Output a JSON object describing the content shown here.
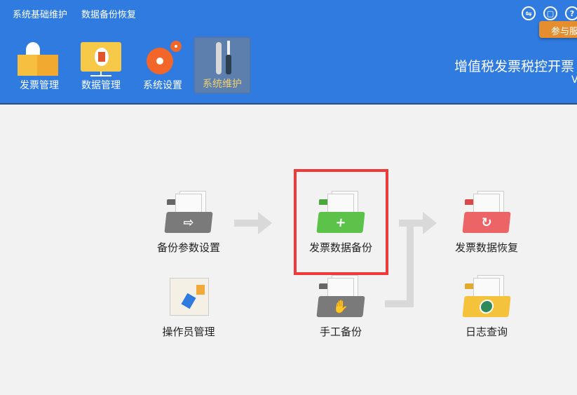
{
  "topmenu": [
    "系统基础维护",
    "数据备份恢复"
  ],
  "nav": [
    {
      "label": "发票管理",
      "icon": "invoice-box-icon"
    },
    {
      "label": "数据管理",
      "icon": "data-folder-icon"
    },
    {
      "label": "系统设置",
      "icon": "gear-icon"
    },
    {
      "label": "系统维护",
      "icon": "tools-icon",
      "active": true
    }
  ],
  "tool_icons": [
    {
      "name": "switch-icon",
      "glyph": "⇋"
    },
    {
      "name": "feedback-icon",
      "glyph": "▢"
    },
    {
      "name": "help-icon",
      "glyph": "?"
    }
  ],
  "tooltip": "参与服",
  "app_title": "增值税发票税控开票",
  "app_version": "V",
  "items": {
    "backup_settings": "备份参数设置",
    "invoice_backup": "发票数据备份",
    "invoice_restore": "发票数据恢复",
    "operator_mgmt": "操作员管理",
    "manual_backup": "手工备份",
    "log_query": "日志查询"
  },
  "colors": {
    "header": "#2f7be0",
    "active_label": "#f0d070",
    "highlight": "#f03a3a",
    "tooltip": "#e48e2f"
  }
}
